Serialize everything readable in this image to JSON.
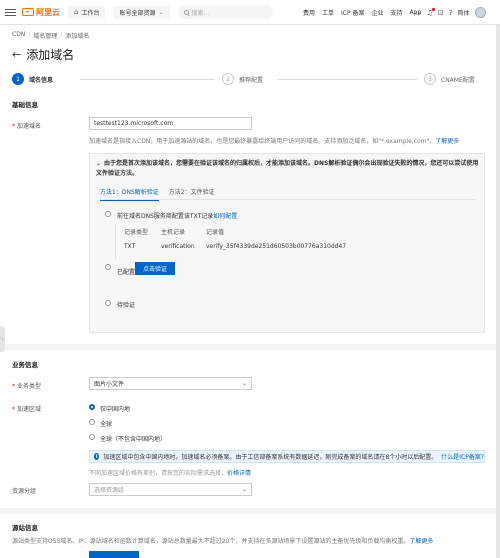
{
  "topnav": {
    "brand": "阿里云",
    "workbench": "工作台",
    "account": "账号全部资源",
    "search_placeholder": "搜索...",
    "links": [
      "费用",
      "工单",
      "ICP 备案",
      "企业",
      "支持",
      "App"
    ],
    "user": "简体"
  },
  "breadcrumb": [
    "CDN",
    "域名管理",
    "添加域名"
  ],
  "page_title": "添加域名",
  "steps": [
    {
      "num": "1",
      "label": "域名信息"
    },
    {
      "num": "2",
      "label": "推荐配置"
    },
    {
      "num": "3",
      "label": "CNAME配置"
    }
  ],
  "basic": {
    "title": "基础信息",
    "domain_label": "加速域名",
    "domain_value": "testtest123.microsoft.com",
    "help_text": "加速域名是指接入CDN，用于加速源站的域名，也是您最终暴露给终端用户访问的域名。支持添加泛域名，如\"*.example.com\"，",
    "help_link": "了解更多",
    "verify_notice": "由于您是首次添加该域名，您需要在验证该域名的归属权后，才能添加该域名。DNS解析验证偶尔会出现验证失败的情况，您还可以尝试使用文件验证方法。",
    "tab_dns": "方法1：DNS解析验证",
    "tab_file": "方法2：文件验证",
    "step1_text": "前往域名DNS服务商配置该TXT记录",
    "step1_link": "如何配置",
    "rec_headers": [
      "记录类型",
      "主机记录",
      "记录值"
    ],
    "rec_values": [
      "TXT",
      "verification",
      "verify_35f4339de251d60503b00776a310dd47"
    ],
    "step2_text": "已配置",
    "verify_button": "点击验证",
    "step3_text": "待验证"
  },
  "business": {
    "title": "业务信息",
    "type_label": "业务类型",
    "type_value": "图片小文件",
    "region_label": "加速区域",
    "regions": [
      "仅中国内地",
      "全球",
      "全球（不包含中国内地）"
    ],
    "notice": "加速区域中包含中国内地时，加速域名必须备案。由于工信部备案系统有数据延迟，刚完成备案的域名请在8个小时以后配置。",
    "notice_link": "什么是ICP备案?",
    "price_note": "不同加速区域价格有差别，请按您的实际需求选择，",
    "price_link": "价格详情",
    "group_label": "资源分组",
    "group_placeholder": "选择资源组"
  },
  "origin": {
    "title": "源站信息",
    "help_text": "源站类型支持OSS域名、IP、源站域名和函数计算域名，源站总数量最大不超过20个，并支持在多源站场景下设置源站的主备优先级和负载均衡权重。",
    "help_link": "了解更多"
  }
}
